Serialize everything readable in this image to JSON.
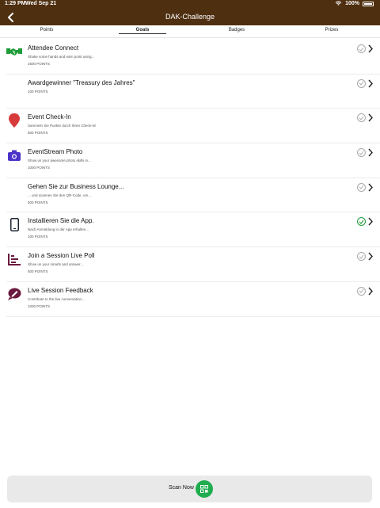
{
  "status": {
    "time": "1:29 PM",
    "date": "Wed Sep 21",
    "battery": "100%"
  },
  "header": {
    "title": "DAK-Challenge"
  },
  "tabs": [
    {
      "label": "Points"
    },
    {
      "label": "Goals",
      "active": true
    },
    {
      "label": "Badges"
    },
    {
      "label": "Prizes"
    }
  ],
  "goals": [
    {
      "title": "Attendee Connect",
      "desc": "Shake some hands and earn point using...",
      "points": "2500 POINTS",
      "icon": "handshake-icon",
      "done": false
    },
    {
      "title": "Awardgewinner \"Treasury des Jahres\"",
      "desc": "",
      "points": "100 POINTS",
      "icon": "",
      "done": false
    },
    {
      "title": "Event Check-In",
      "desc": "Sammeln Sie Punkte durch Ihren Check-In!",
      "points": "500 POINTS",
      "icon": "map-pin-icon",
      "done": false
    },
    {
      "title": "EventStream Photo",
      "desc": "Show us your awesome photo skills in...",
      "points": "1000 POINTS",
      "icon": "camera-icon",
      "done": false
    },
    {
      "title": "Gehen Sie zur Business Lounge...",
      "desc": "... und scannen Sie den QR-Code, um...",
      "points": "500 POINTS",
      "icon": "",
      "done": false
    },
    {
      "title": "Installieren Sie die App.",
      "desc": "Nach Anmeldung in der App erhalten...",
      "points": "100 POINTS",
      "icon": "phone-icon",
      "done": true
    },
    {
      "title": "Join a Session Live Poll",
      "desc": "Show us your smarts and answer...",
      "points": "500 POINTS",
      "icon": "poll-icon",
      "done": false
    },
    {
      "title": "Live Session Feedback",
      "desc": "Contribute to the live conversation...",
      "points": "1000 POINTS",
      "icon": "feedback-icon",
      "done": false
    }
  ],
  "footer": {
    "scan_label": "Scan Now"
  },
  "colors": {
    "header": "#4e2f10",
    "accent_green": "#1fad4f",
    "pin_red": "#d63a3a",
    "camera_purple": "#4b33c9",
    "poll_maroon": "#6a1a3e"
  }
}
